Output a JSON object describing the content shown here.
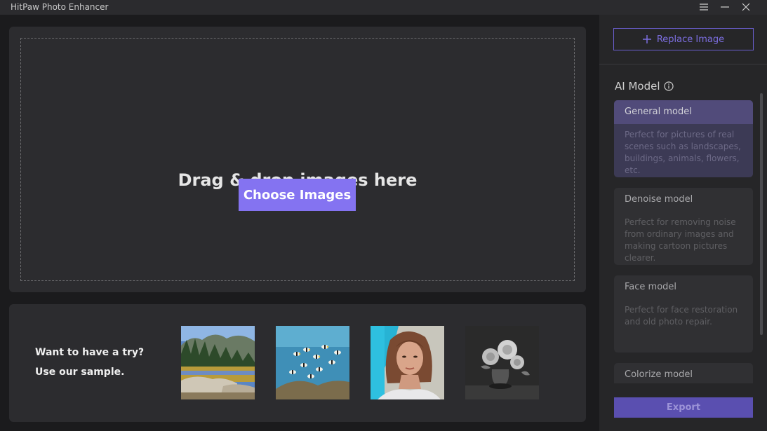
{
  "window": {
    "title": "HitPaw Photo Enhancer",
    "controls": [
      "menu-icon",
      "minimize-icon",
      "close-icon"
    ]
  },
  "upload": {
    "drop_text": "Drag & drop images here",
    "choose_label": "Choose Images"
  },
  "samples": {
    "line1": "Want to have a try?",
    "line2": "Use our sample.",
    "thumbnails": [
      "landscape-sample",
      "fish-sample",
      "portrait-sample",
      "flowers-sample"
    ]
  },
  "sidebar": {
    "replace_label": "Replace Image",
    "ai_model_label": "AI Model",
    "models": [
      {
        "name": "General model",
        "desc": "Perfect for pictures of real scenes such as landscapes, buildings, animals, flowers, etc.",
        "selected": true
      },
      {
        "name": "Denoise model",
        "desc": "Perfect for removing noise from ordinary images and making cartoon pictures clearer.",
        "selected": false
      },
      {
        "name": "Face model",
        "desc": "Perfect for face restoration and old photo repair.",
        "selected": false
      },
      {
        "name": "Colorize model",
        "desc": "",
        "selected": false
      }
    ],
    "export_label": "Export"
  },
  "colors": {
    "accent": "#8473f1",
    "selected_header": "#514b7a",
    "export_bg": "#5a4fb0"
  }
}
